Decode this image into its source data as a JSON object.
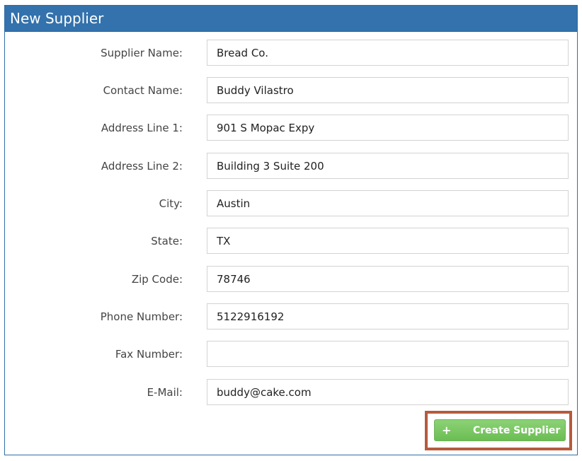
{
  "panel": {
    "title": "New Supplier"
  },
  "form": {
    "fields": [
      {
        "label": "Supplier Name:",
        "value": "Bread Co."
      },
      {
        "label": "Contact Name:",
        "value": "Buddy Vilastro"
      },
      {
        "label": "Address Line 1:",
        "value": "901 S Mopac Expy"
      },
      {
        "label": "Address Line 2:",
        "value": "Building 3 Suite 200"
      },
      {
        "label": "City:",
        "value": "Austin"
      },
      {
        "label": "State:",
        "value": "TX"
      },
      {
        "label": "Zip Code:",
        "value": "78746"
      },
      {
        "label": "Phone Number:",
        "value": "5122916192"
      },
      {
        "label": "Fax Number:",
        "value": ""
      },
      {
        "label": "E-Mail:",
        "value": "buddy@cake.com"
      }
    ]
  },
  "create_button": {
    "icon": "plus-icon",
    "icon_glyph": "+",
    "label": "Create Supplier"
  },
  "colors": {
    "header": "#3372ac",
    "button": "#6bbd53",
    "highlight": "#b75a3d"
  }
}
